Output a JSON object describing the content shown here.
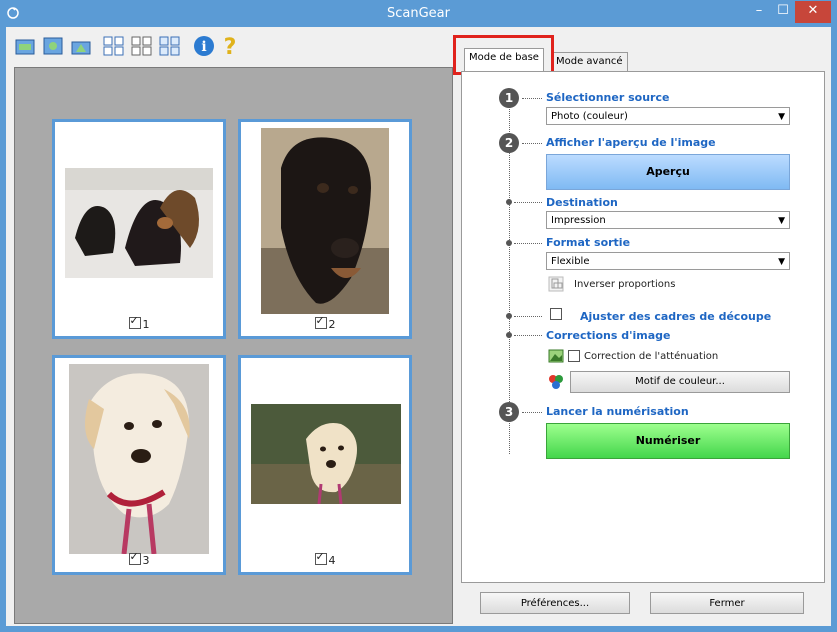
{
  "window": {
    "title": "ScanGear",
    "minimize": "–",
    "maximize": "☐",
    "close": "✕"
  },
  "toolbar": {
    "icons": [
      "scan-left-icon",
      "scan-middle-icon",
      "scan-right-icon",
      "thumbnail-grid-icon",
      "thumbnail-2x2-icon",
      "thumbnail-whole-icon",
      "info-icon",
      "help-icon"
    ]
  },
  "thumbnails": [
    {
      "label": "1",
      "checked": true
    },
    {
      "label": "2",
      "checked": true
    },
    {
      "label": "3",
      "checked": true
    },
    {
      "label": "4",
      "checked": true
    }
  ],
  "tabs": {
    "basic": "Mode de base",
    "advanced": "Mode avancé"
  },
  "steps": {
    "one": "1",
    "two": "2",
    "three": "3"
  },
  "panel": {
    "select_source_label": "Sélectionner source",
    "source_value": "Photo (couleur)",
    "preview_label": "Afficher l'aperçu de l'image",
    "preview_button": "Aperçu",
    "destination_label": "Destination",
    "destination_value": "Impression",
    "output_size_label": "Format sortie",
    "output_size_value": "Flexible",
    "invert_ratio": "Inverser proportions",
    "adjust_crop_label": "Ajuster des cadres de découpe",
    "image_corrections_label": "Corrections d'image",
    "fading_correction": "Correction de l'atténuation",
    "color_pattern_button": "Motif de couleur...",
    "start_scan_label": "Lancer la numérisation",
    "scan_button": "Numériser"
  },
  "bottom": {
    "preferences": "Préférences...",
    "close": "Fermer"
  },
  "colors": {
    "accent": "#5b9bd5",
    "link": "#1e66c3",
    "highlight": "#e0221c",
    "scan_green": "#44d64b"
  }
}
